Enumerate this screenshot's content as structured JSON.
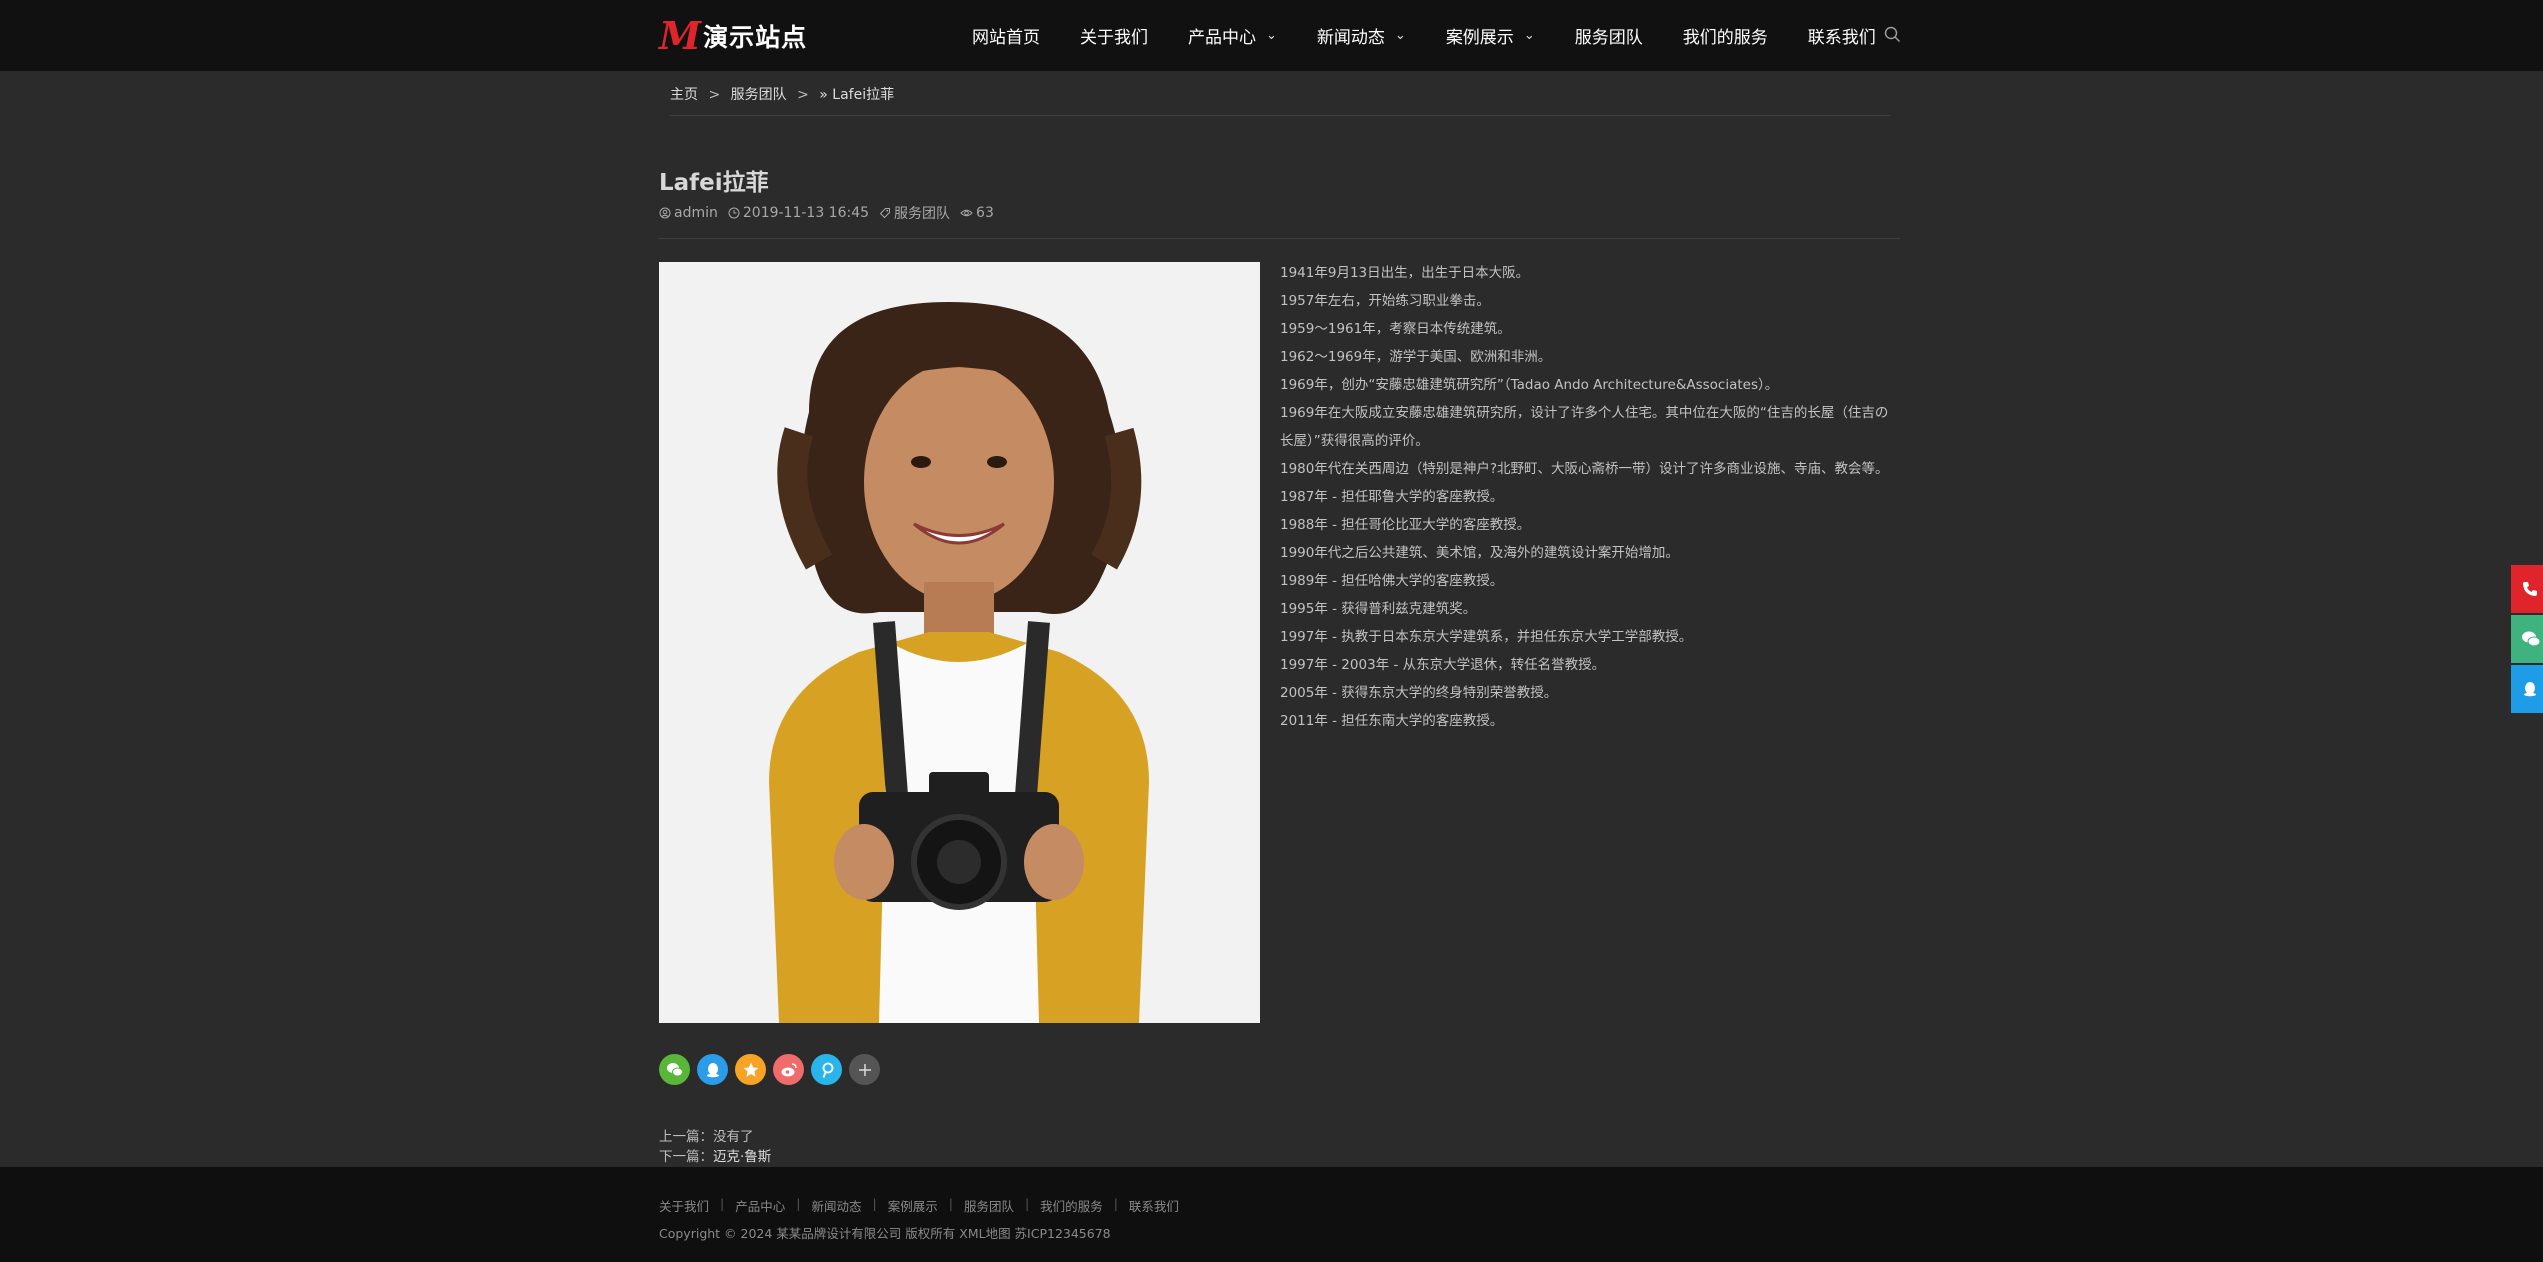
{
  "header": {
    "logo_mark": "M",
    "logo_text": "演示站点",
    "nav": [
      {
        "label": "网站首页",
        "has_dropdown": false
      },
      {
        "label": "关于我们",
        "has_dropdown": false
      },
      {
        "label": "产品中心",
        "has_dropdown": true
      },
      {
        "label": "新闻动态",
        "has_dropdown": true
      },
      {
        "label": "案例展示",
        "has_dropdown": true
      },
      {
        "label": "服务团队",
        "has_dropdown": false
      },
      {
        "label": "我们的服务",
        "has_dropdown": false
      },
      {
        "label": "联系我们",
        "has_dropdown": false
      }
    ]
  },
  "breadcrumb": {
    "home": "主页",
    "sep": ">",
    "category": "服务团队",
    "current": "» Lafei拉菲"
  },
  "post": {
    "title": "Lafei拉菲",
    "author": "admin",
    "date": "2019-11-13 16:45",
    "category": "服务团队",
    "views": "63"
  },
  "bio": [
    "1941年9月13日出生，出生于日本大阪。",
    "1957年左右，开始练习职业拳击。",
    "1959～1961年，考察日本传统建筑。",
    "1962～1969年，游学于美国、欧洲和非洲。",
    "1969年，创办“安藤忠雄建筑研究所”（Tadao Ando Architecture&Associates）。",
    "1969年在大阪成立安藤忠雄建筑研究所，设计了许多个人住宅。其中位在大阪的“住吉的长屋（住吉の长屋）”获得很高的评价。",
    "1980年代在关西周边（特别是神户?北野町、大阪心斋桥一带）设计了许多商业设施、寺庙、教会等。",
    "1987年 - 担任耶鲁大学的客座教授。",
    "1988年 - 担任哥伦比亚大学的客座教授。",
    "1990年代之后公共建筑、美术馆，及海外的建筑设计案开始增加。",
    "1989年 - 担任哈佛大学的客座教授。",
    "1995年 - 获得普利兹克建筑奖。",
    "1997年 - 执教于日本东京大学建筑系，并担任东京大学工学部教授。",
    "1997年 - 2003年 - 从东京大学退休，转任名誉教授。",
    "2005年 - 获得东京大学的终身特别荣誉教授。",
    "2011年 - 担任东南大学的客座教授。"
  ],
  "share": [
    {
      "icon": "wechat-icon",
      "color": "#5ab639"
    },
    {
      "icon": "qq-icon",
      "color": "#2a9ce8"
    },
    {
      "icon": "qzone-icon",
      "color": "#f7a325"
    },
    {
      "icon": "weibo-icon",
      "color": "#f06b6b"
    },
    {
      "icon": "pinterest-icon",
      "color": "#2ab4ec"
    },
    {
      "icon": "more-icon",
      "color": "#555555"
    }
  ],
  "prevnext": {
    "prev_label": "上一篇：",
    "prev_value": "没有了",
    "next_label": "下一篇：",
    "next_value": "迈克·鲁斯"
  },
  "footer": {
    "links": [
      "关于我们",
      "产品中心",
      "新闻动态",
      "案例展示",
      "服务团队",
      "我们的服务",
      "联系我们"
    ],
    "copyright": "Copyright © 2024 某某品牌设计有限公司 版权所有  XML地图  苏ICP12345678"
  },
  "side_float": [
    {
      "icon": "phone-icon",
      "color": "#e0242b"
    },
    {
      "icon": "wechat-icon",
      "color": "#3fb27f"
    },
    {
      "icon": "qq-icon",
      "color": "#1e9de6"
    }
  ]
}
